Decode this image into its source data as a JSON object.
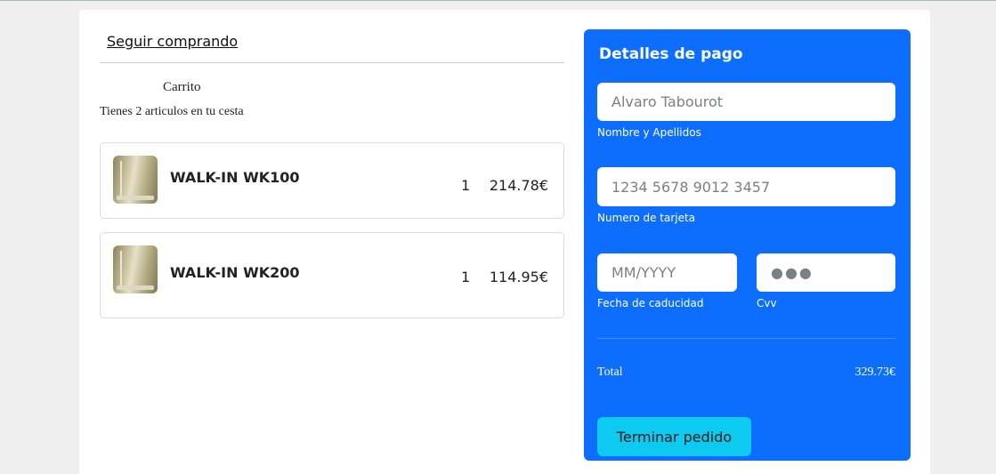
{
  "nav": {
    "continue_shopping": "Seguir comprando"
  },
  "cart": {
    "title": "Carrito",
    "summary": "Tienes 2 articulos en tu cesta",
    "items": [
      {
        "name": "WALK-IN WK100",
        "quantity": "1",
        "price": "214.78€"
      },
      {
        "name": "WALK-IN WK200",
        "quantity": "1",
        "price": "114.95€"
      }
    ]
  },
  "payment": {
    "title": "Detalles de pago",
    "name_placeholder": "Alvaro Tabourot",
    "name_label": "Nombre y Apellidos",
    "card_placeholder": "1234 5678 9012 3457",
    "card_label": "Numero de tarjeta",
    "expiry_placeholder": "MM/YYYY",
    "expiry_label": "Fecha de caducidad",
    "cvv_placeholder": "●●●",
    "cvv_label": "Cvv",
    "total_label": "Total",
    "total_value": "329.73€",
    "submit_label": "Terminar pedido"
  },
  "colors": {
    "panel": "#0d6efd",
    "button": "#0dcaf0",
    "page_background": "#efefef"
  }
}
